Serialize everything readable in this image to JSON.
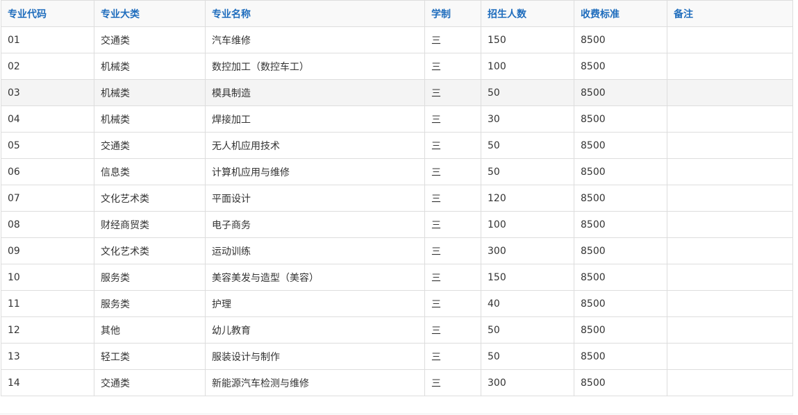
{
  "table": {
    "headers": [
      "专业代码",
      "专业大类",
      "专业名称",
      "学制",
      "招生人数",
      "收费标准",
      "备注"
    ],
    "rows": [
      [
        "01",
        "交通类",
        "汽车维修",
        "三",
        "150",
        "8500",
        ""
      ],
      [
        "02",
        "机械类",
        "数控加工（数控车工）",
        "三",
        "100",
        "8500",
        ""
      ],
      [
        "03",
        "机械类",
        "模具制造",
        "三",
        "50",
        "8500",
        ""
      ],
      [
        "04",
        "机械类",
        "焊接加工",
        "三",
        "30",
        "8500",
        ""
      ],
      [
        "05",
        "交通类",
        "无人机应用技术",
        "三",
        "50",
        "8500",
        ""
      ],
      [
        "06",
        "信息类",
        "计算机应用与维修",
        "三",
        "50",
        "8500",
        ""
      ],
      [
        "07",
        "文化艺术类",
        "平面设计",
        "三",
        "120",
        "8500",
        ""
      ],
      [
        "08",
        "财经商贸类",
        "电子商务",
        "三",
        "100",
        "8500",
        ""
      ],
      [
        "09",
        "文化艺术类",
        "运动训练",
        "三",
        "300",
        "8500",
        ""
      ],
      [
        "10",
        "服务类",
        "美容美发与造型（美容）",
        "三",
        "150",
        "8500",
        ""
      ],
      [
        "11",
        "服务类",
        "护理",
        "三",
        "40",
        "8500",
        ""
      ],
      [
        "12",
        "其他",
        "幼儿教育",
        "三",
        "50",
        "8500",
        ""
      ],
      [
        "13",
        "轻工类",
        "服装设计与制作",
        "三",
        "50",
        "8500",
        ""
      ],
      [
        "14",
        "交通类",
        "新能源汽车检测与维修",
        "三",
        "300",
        "8500",
        ""
      ]
    ]
  },
  "colors": {
    "header_text": "#1f6dbd",
    "border": "#dddddd",
    "row_highlight": "#f4f4f4"
  }
}
